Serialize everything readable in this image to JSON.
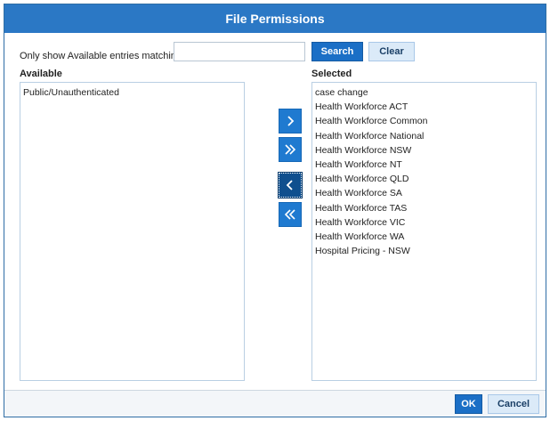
{
  "dialog": {
    "title": "File Permissions"
  },
  "filter": {
    "label": "Only show Available entries matching:",
    "value": "",
    "placeholder": "",
    "search_label": "Search",
    "clear_label": "Clear"
  },
  "available": {
    "heading": "Available",
    "items": [
      "Public/Unauthenticated"
    ]
  },
  "selected": {
    "heading": "Selected",
    "items": [
      "case change",
      "Health Workforce ACT",
      "Health Workforce Common",
      "Health Workforce National",
      "Health Workforce NSW",
      "Health Workforce NT",
      "Health Workforce QLD",
      "Health Workforce SA",
      "Health Workforce TAS",
      "Health Workforce VIC",
      "Health Workforce WA",
      "Hospital Pricing - NSW"
    ]
  },
  "move_buttons": {
    "icons": [
      "chevron-right-icon",
      "double-chevron-right-icon",
      "chevron-left-icon",
      "double-chevron-left-icon"
    ],
    "active_index": 2
  },
  "footer": {
    "ok_label": "OK",
    "cancel_label": "Cancel"
  },
  "colors": {
    "titlebar": "#2b78c5",
    "primary_button": "#1b6fc6",
    "secondary_button": "#dbeaf8",
    "move_button": "#1f7ad0",
    "move_button_active": "#0f4f8e"
  }
}
